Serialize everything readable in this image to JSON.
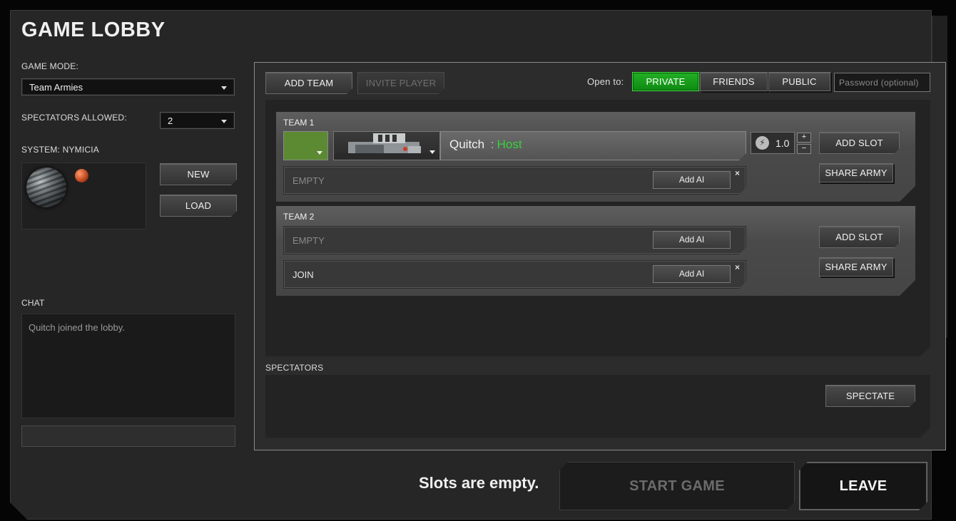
{
  "title": "GAME LOBBY",
  "left": {
    "game_mode_label": "GAME MODE:",
    "game_mode_value": "Team Armies",
    "spectators_label": "SPECTATORS ALLOWED:",
    "spectators_value": "2",
    "system_label": "SYSTEM: NYMICIA",
    "new_label": "NEW",
    "load_label": "LOAD",
    "chat_label": "CHAT",
    "chat_messages": [
      "Quitch joined the lobby."
    ]
  },
  "toolbar": {
    "add_team_label": "ADD TEAM",
    "invite_player_label": "INVITE PLAYER",
    "open_to_label": "Open to:",
    "private_label": "PRIVATE",
    "friends_label": "FRIENDS",
    "public_label": "PUBLIC",
    "password_placeholder": "Password (optional)"
  },
  "teams": [
    {
      "label": "TEAM 1",
      "player": {
        "name": "Quitch",
        "separator": ":",
        "role": "Host",
        "color": "#5b8a32",
        "eco": "1.0"
      },
      "slots": [
        {
          "text": "EMPTY",
          "add_ai": "Add AI",
          "close": "×"
        }
      ],
      "add_slot_label": "ADD SLOT",
      "share_army_label": "SHARE ARMY"
    },
    {
      "label": "TEAM 2",
      "slots": [
        {
          "text": "EMPTY",
          "add_ai": "Add AI"
        },
        {
          "text": "JOIN",
          "add_ai": "Add AI",
          "close": "×"
        }
      ],
      "add_slot_label": "ADD SLOT",
      "share_army_label": "SHARE ARMY"
    }
  ],
  "eco_plus": "+",
  "eco_minus": "−",
  "spectators": {
    "label": "SPECTATORS",
    "spectate_label": "SPECTATE"
  },
  "footer": {
    "status": "Slots are empty.",
    "start_game_label": "START GAME",
    "leave_label": "LEAVE"
  },
  "colors": {
    "accent_green": "#1aa51f",
    "host_green": "#36d23c",
    "team1_color": "#5b8a32"
  }
}
